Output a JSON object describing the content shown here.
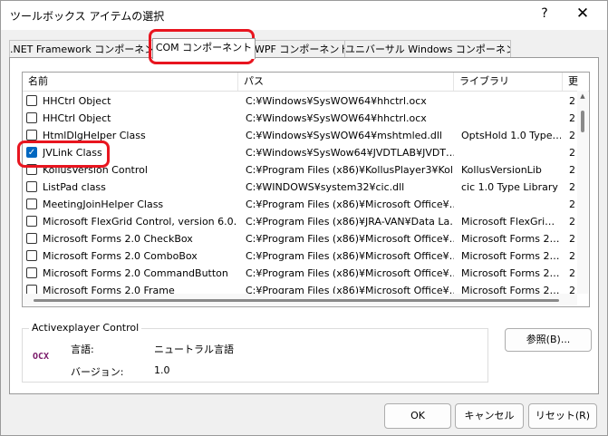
{
  "window": {
    "title": "ツールボックス アイテムの選択",
    "help": "?",
    "close": "✕"
  },
  "tabs": [
    {
      "label": ".NET Framework コンポーネント"
    },
    {
      "label": "COM コンポーネント"
    },
    {
      "label": "WPF コンポーネント"
    },
    {
      "label": "ユニバーサル Windows コンポーネント"
    }
  ],
  "columns": [
    "名前",
    "パス",
    "ライブラリ",
    "更"
  ],
  "rows": [
    {
      "checked": false,
      "name": "HHCtrl Object",
      "path": "C:¥Windows¥SysWOW64¥hhctrl.ocx",
      "library": "",
      "extra": "2"
    },
    {
      "checked": false,
      "name": "HHCtrl Object",
      "path": "C:¥Windows¥SysWOW64¥hhctrl.ocx",
      "library": "",
      "extra": "2"
    },
    {
      "checked": false,
      "name": "HtmlDlgHelper Class",
      "path": "C:¥Windows¥SysWOW64¥mshtmled.dll",
      "library": "OptsHold 1.0 Type…",
      "extra": "2"
    },
    {
      "checked": true,
      "name": "JVLink Class",
      "path": "C:¥Windows¥SysWow64¥JVDTLAB¥JVDT…",
      "library": "",
      "extra": "2"
    },
    {
      "checked": false,
      "name": "KollusVersion Control",
      "path": "C:¥Program Files (x86)¥KollusPlayer3¥Kol…",
      "library": "KollusVersionLib",
      "extra": "2"
    },
    {
      "checked": false,
      "name": "ListPad class",
      "path": "C:¥WINDOWS¥system32¥cic.dll",
      "library": "cic 1.0 Type Library",
      "extra": "2"
    },
    {
      "checked": false,
      "name": "MeetingJoinHelper Class",
      "path": "C:¥Program Files (x86)¥Microsoft Office¥…",
      "library": "",
      "extra": "2"
    },
    {
      "checked": false,
      "name": "Microsoft FlexGrid Control, version 6.0…",
      "path": "C:¥Program Files (x86)¥JRA-VAN¥Data La…",
      "library": "Microsoft FlexGri…",
      "extra": "2"
    },
    {
      "checked": false,
      "name": "Microsoft Forms 2.0 CheckBox",
      "path": "C:¥Program Files (x86)¥Microsoft Office¥…",
      "library": "Microsoft Forms 2…",
      "extra": "2"
    },
    {
      "checked": false,
      "name": "Microsoft Forms 2.0 ComboBox",
      "path": "C:¥Program Files (x86)¥Microsoft Office¥…",
      "library": "Microsoft Forms 2…",
      "extra": "2"
    },
    {
      "checked": false,
      "name": "Microsoft Forms 2.0 CommandButton",
      "path": "C:¥Program Files (x86)¥Microsoft Office¥…",
      "library": "Microsoft Forms 2…",
      "extra": "2"
    },
    {
      "checked": false,
      "name": "Microsoft Forms 2.0 Frame",
      "path": "C:¥Program Files (x86)¥Microsoft Office¥…",
      "library": "Microsoft Forms 2…",
      "extra": "2"
    }
  ],
  "details": {
    "group_title": "Activexplayer Control",
    "icon_text": "OCX",
    "language_label": "言語:",
    "language_value": "ニュートラル言語",
    "version_label": "バージョン:",
    "version_value": "1.0"
  },
  "buttons": {
    "browse": "参照(B)...",
    "ok": "OK",
    "cancel": "キャンセル",
    "reset": "リセット(R)"
  },
  "colors": {
    "highlight": "#e8151f",
    "checkbox": "#0067c0"
  }
}
